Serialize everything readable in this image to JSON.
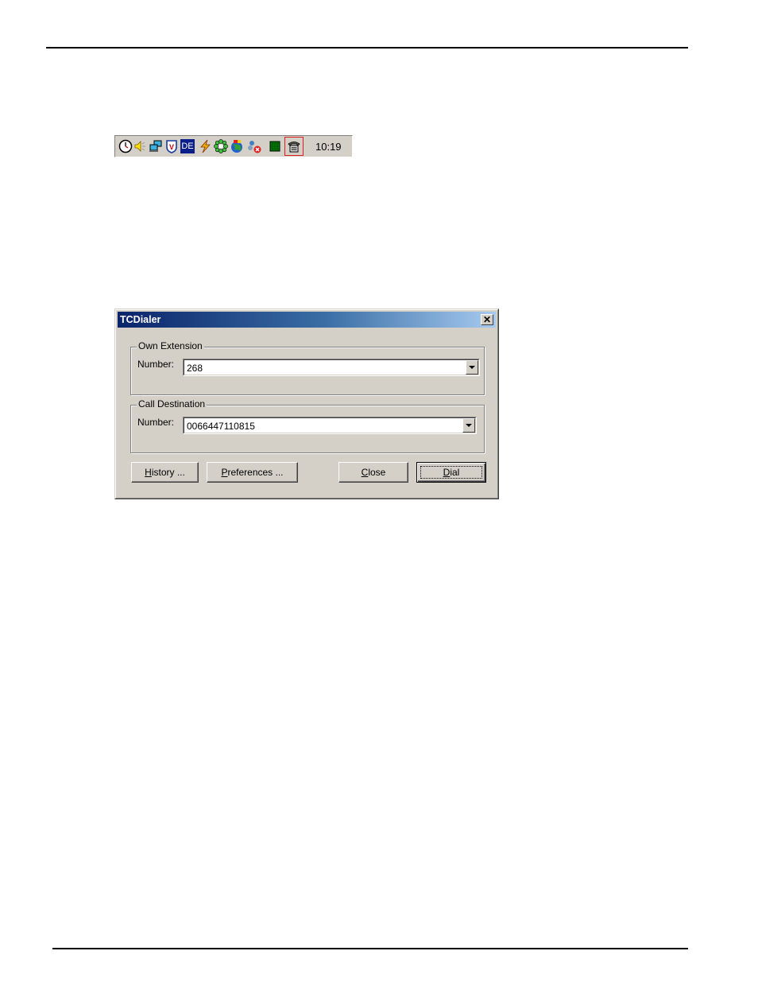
{
  "tray": {
    "icons": [
      "clock-icon",
      "speaker-icon",
      "network-icon",
      "antivirus-shield-icon",
      "language-de-icon",
      "power-icon",
      "flower-icon",
      "globe-icon",
      "network-error-icon",
      "meter-icon",
      "telephone-icon"
    ],
    "language_label": "DE",
    "clock": "10:19",
    "highlight_color": "#e02020"
  },
  "dialog": {
    "title": "TCDialer",
    "close_glyph": "✕",
    "own_extension": {
      "legend": "Own Extension",
      "label": "Number:",
      "value": "268"
    },
    "call_destination": {
      "legend": "Call Destination",
      "label": "Number:",
      "value": "0066447110815"
    },
    "buttons": {
      "history": {
        "accel": "H",
        "rest": "istory ..."
      },
      "preferences": {
        "accel": "P",
        "rest": "references ..."
      },
      "close": {
        "accel": "C",
        "rest": "lose"
      },
      "dial": {
        "accel": "D",
        "rest": "ial"
      }
    }
  }
}
